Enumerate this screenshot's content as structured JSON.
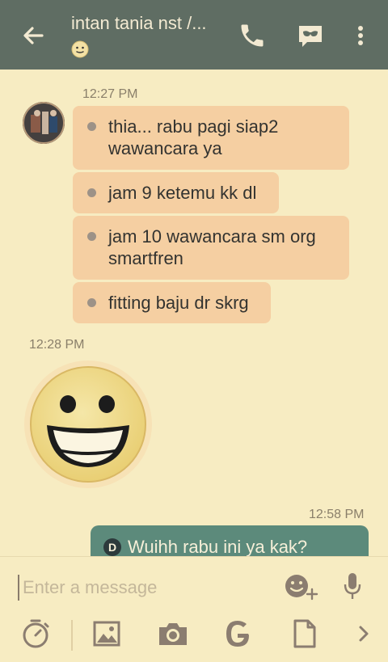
{
  "header": {
    "contact_name": "intan tania nst /...",
    "status_emoji": "slightly-smiling-face"
  },
  "messages": {
    "group1": {
      "time": "12:27 PM",
      "items": [
        "thia... rabu pagi siap2 wawancara ya",
        "jam 9 ketemu kk dl",
        "jam 10 wawancara sm org smartfren",
        "fitting baju dr skrg"
      ]
    },
    "group2": {
      "time": "12:28 PM",
      "sticker": "grinning-face-sticker"
    },
    "outgoing": {
      "time": "12:58 PM",
      "badge": "D",
      "text": "Wuihh rabu ini ya kak?"
    }
  },
  "compose": {
    "placeholder": "Enter a message"
  },
  "colors": {
    "header_bg": "#5f6d63",
    "chat_bg": "#f7ecc2",
    "incoming_bubble": "#f5cfa2",
    "outgoing_bubble": "#5c8a7b",
    "icon_color": "#8b7d70"
  }
}
